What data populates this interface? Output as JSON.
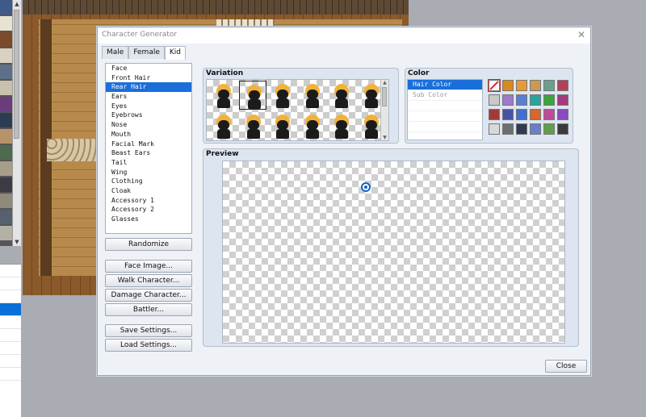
{
  "window": {
    "title": "Character Generator"
  },
  "tabs": [
    "Male",
    "Female",
    "Kid"
  ],
  "parts": [
    "Face",
    "Front Hair",
    "Rear Hair",
    "Ears",
    "Eyes",
    "Eyebrows",
    "Nose",
    "Mouth",
    "Facial Mark",
    "Beast Ears",
    "Tail",
    "Wing",
    "Clothing",
    "Cloak",
    "Accessory 1",
    "Accessory 2",
    "Glasses"
  ],
  "selected_part": "Rear Hair",
  "buttons": {
    "randomize": "Randomize",
    "face_image": "Face Image...",
    "walk_character": "Walk Character...",
    "damage_character": "Damage Character...",
    "battler": "Battler...",
    "save_settings": "Save Settings...",
    "load_settings": "Load Settings...",
    "close": "Close"
  },
  "variation": {
    "label": "Variation",
    "count": 12,
    "selected_index": 1
  },
  "color": {
    "label": "Color",
    "targets": [
      "Hair Color",
      "Sub Color"
    ],
    "selected_target": "Hair Color",
    "swatches": [
      "none",
      "#d98a1c",
      "#e79a33",
      "#c99a52",
      "#6aa08e",
      "#b24158",
      "#c9c9c9",
      "#9d7ac8",
      "#5a7fd0",
      "#2aa39a",
      "#3ea33c",
      "#a23a7c",
      "#a33a3a",
      "#4a52a8",
      "#3f6fd0",
      "#d5682a",
      "#c04a9a",
      "#8a4ac0",
      "#d9d9d9",
      "#6e6e6e",
      "#2d3c4f",
      "#6b7fc9",
      "#5ea04a",
      "#3a3a3a"
    ]
  },
  "preview": {
    "label": "Preview"
  }
}
